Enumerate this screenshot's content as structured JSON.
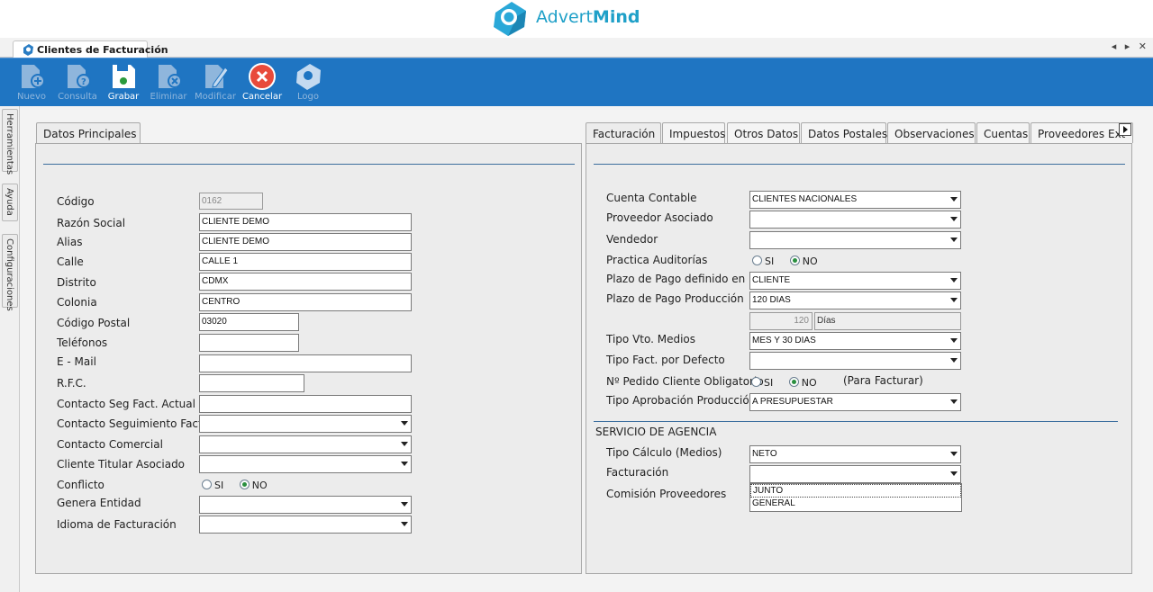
{
  "brand": {
    "name_part1": "Advert",
    "name_part2": "Mind"
  },
  "document_tab": {
    "label": "Clientes de Facturación",
    "nav": "◂ ▸ ✕"
  },
  "toolbar": {
    "nuevo": "Nuevo",
    "consulta": "Consulta",
    "grabar": "Grabar",
    "eliminar": "Eliminar",
    "modificar": "Modificar",
    "cancelar": "Cancelar",
    "logo": "Logo"
  },
  "side_tabs": {
    "herramientas": "Herramientas",
    "ayuda": "Ayuda",
    "configuraciones": "Configuraciones"
  },
  "left_panel": {
    "tab": "Datos Principales",
    "labels": {
      "codigo": "Código",
      "razon_social": "Razón Social",
      "alias": "Alias",
      "calle": "Calle",
      "distrito": "Distrito",
      "colonia": "Colonia",
      "codigo_postal": "Código Postal",
      "telefonos": "Teléfonos",
      "email": " E - Mail",
      "rfc": "R.F.C.",
      "contacto_seg_actual": "Contacto Seg Fact. Actual",
      "contacto_seguimiento": "Contacto Seguimiento Fact.",
      "contacto_comercial": "Contacto Comercial",
      "cliente_titular": "Cliente Titular Asociado",
      "conflicto": "Conflicto",
      "genera_entidad": "Genera Entidad",
      "idioma": "Idioma de Facturación"
    },
    "values": {
      "codigo": "0162",
      "razon_social": "CLIENTE DEMO",
      "alias": "CLIENTE DEMO",
      "calle": "CALLE 1",
      "distrito": "CDMX",
      "colonia": "CENTRO",
      "codigo_postal": "03020",
      "telefonos": "",
      "email": "",
      "rfc": "",
      "contacto_seg_actual": "",
      "contacto_seguimiento": "",
      "contacto_comercial": "",
      "cliente_titular": "",
      "genera_entidad": "",
      "idioma": ""
    },
    "radio": {
      "si": "SI",
      "no": "NO"
    }
  },
  "right_panel": {
    "tabs": [
      "Facturación",
      "Impuestos",
      "Otros Datos",
      "Datos Postales",
      "Observaciones",
      "Cuentas",
      "Proveedores Ext"
    ],
    "labels": {
      "cuenta_contable": "Cuenta Contable",
      "proveedor_asociado": "Proveedor Asociado",
      "vendedor": "Vendedor",
      "practica_auditorias": "Practica Auditorías",
      "plazo_pago_definido": "Plazo de Pago definido en",
      "plazo_pago_produccion": "Plazo de Pago Producción",
      "tipo_vto_medios": "Tipo Vto. Medios",
      "tipo_fact_defecto": "Tipo Fact. por Defecto",
      "pedido_cliente": "Nº Pedido Cliente Obligatorio",
      "para_facturar": "(Para Facturar)",
      "tipo_aprobacion": "Tipo Aprobación Producción",
      "servicio_agencia": "SERVICIO DE AGENCIA",
      "tipo_calculo": "Tipo Cálculo (Medios)",
      "facturacion": "Facturación",
      "comision_proveedores": "Comisión Proveedores"
    },
    "values": {
      "cuenta_contable": "CLIENTES NACIONALES",
      "proveedor_asociado": "",
      "vendedor": "",
      "plazo_pago_definido": "CLIENTE",
      "plazo_pago_produccion": "120 DIAS",
      "dias_num": "120",
      "dias_unit": "Días",
      "tipo_vto_medios": "MES Y 30 DIAS",
      "tipo_fact_defecto": "",
      "tipo_aprobacion": "A PRESUPUESTAR",
      "tipo_calculo": "NETO",
      "facturacion": ""
    },
    "radio": {
      "si": "SI",
      "no": "NO"
    },
    "facturacion_options": [
      "JUNTO",
      "GENERAL"
    ]
  }
}
